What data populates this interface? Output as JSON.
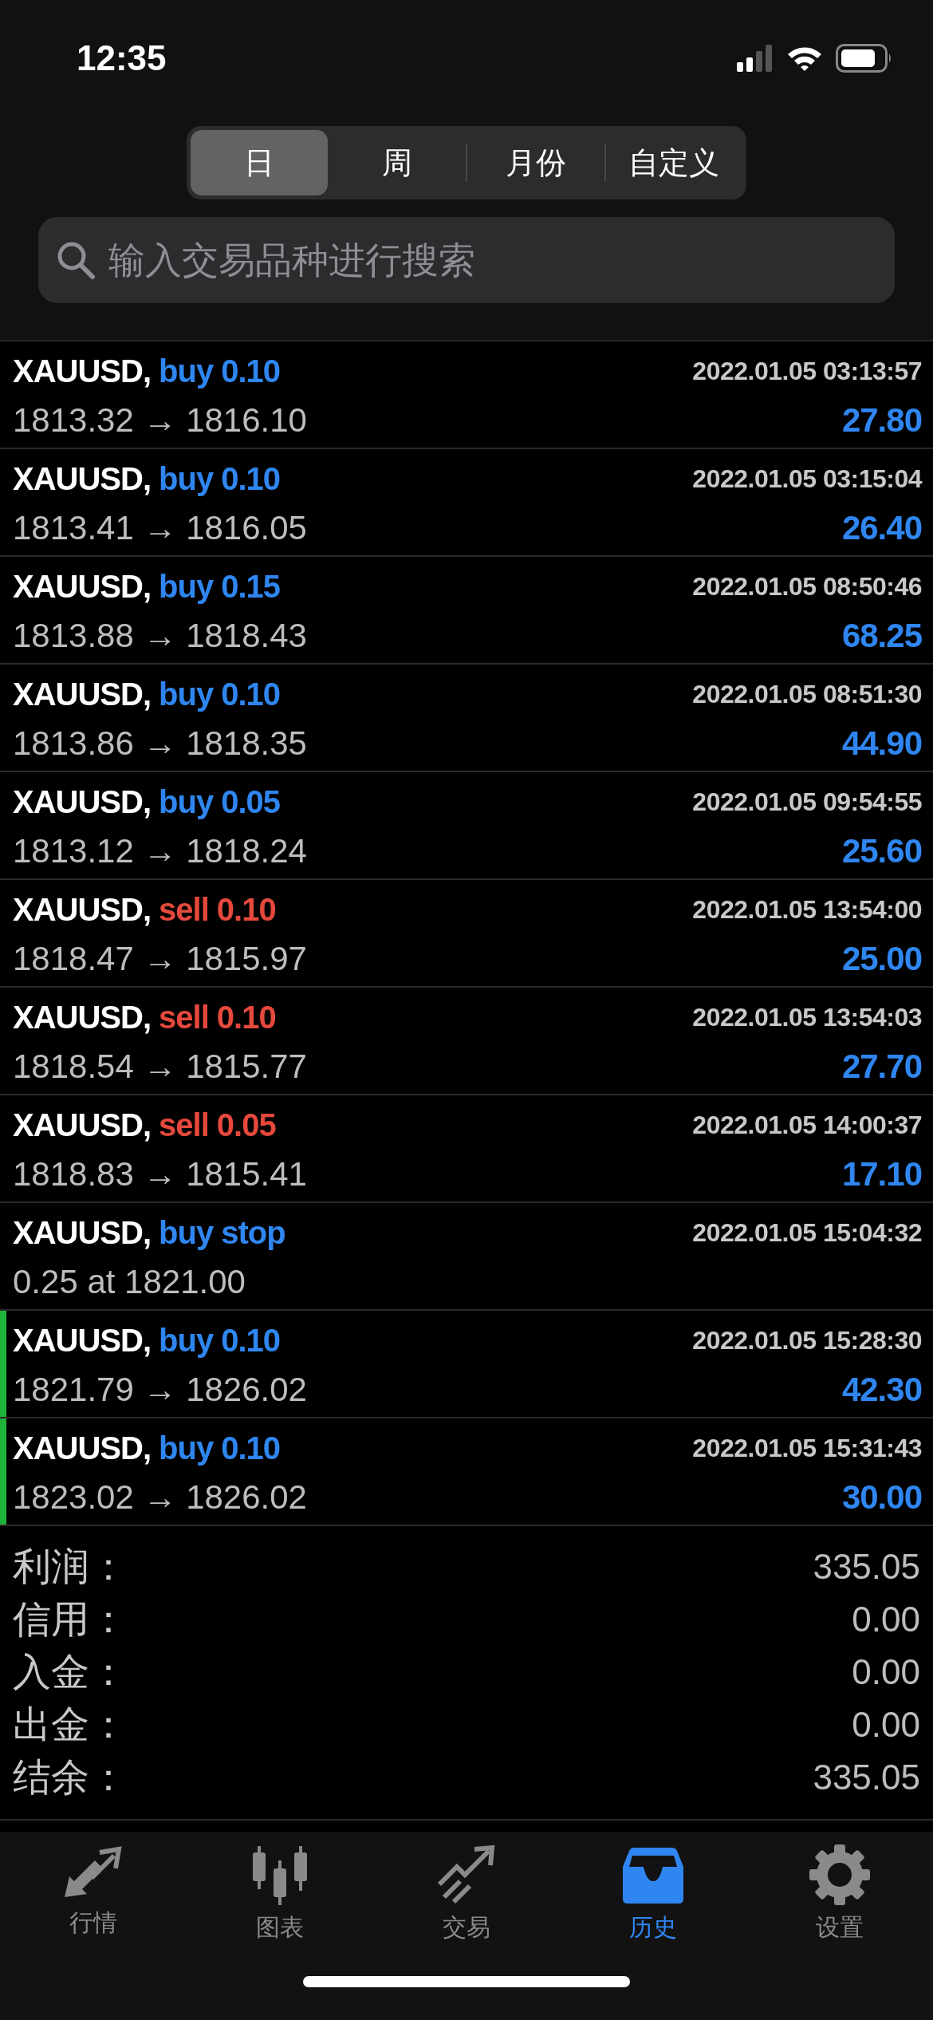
{
  "status_bar": {
    "time": "12:35"
  },
  "period_tabs": [
    {
      "label": "日",
      "selected": true
    },
    {
      "label": "周",
      "selected": false
    },
    {
      "label": "月份",
      "selected": false
    },
    {
      "label": "自定义",
      "selected": false
    }
  ],
  "search": {
    "placeholder": "输入交易品种进行搜索"
  },
  "deals": [
    {
      "kind": "deal",
      "symbol": "XAUUSD,",
      "color": "#2f86f0",
      "order": "buy 0.10",
      "time": "2022.01.05 03:13:57",
      "prices": "1813.32 → 1816.10",
      "profit": "27.80",
      "highlighted": false
    },
    {
      "kind": "deal",
      "symbol": "XAUUSD,",
      "color": "#2f86f0",
      "order": "buy 0.10",
      "time": "2022.01.05 03:15:04",
      "prices": "1813.41 → 1816.05",
      "profit": "26.40",
      "highlighted": false
    },
    {
      "kind": "deal",
      "symbol": "XAUUSD,",
      "color": "#2f86f0",
      "order": "buy 0.15",
      "time": "2022.01.05 08:50:46",
      "prices": "1813.88 → 1818.43",
      "profit": "68.25",
      "highlighted": false
    },
    {
      "kind": "deal",
      "symbol": "XAUUSD,",
      "color": "#2f86f0",
      "order": "buy 0.10",
      "time": "2022.01.05 08:51:30",
      "prices": "1813.86 → 1818.35",
      "profit": "44.90",
      "highlighted": false
    },
    {
      "kind": "deal",
      "symbol": "XAUUSD,",
      "color": "#2f86f0",
      "order": "buy 0.05",
      "time": "2022.01.05 09:54:55",
      "prices": "1813.12 → 1818.24",
      "profit": "25.60",
      "highlighted": false
    },
    {
      "kind": "deal",
      "symbol": "XAUUSD,",
      "color": "#e5483c",
      "order": "sell 0.10",
      "time": "2022.01.05 13:54:00",
      "prices": "1818.47 → 1815.97",
      "profit": "25.00",
      "highlighted": false
    },
    {
      "kind": "deal",
      "symbol": "XAUUSD,",
      "color": "#e5483c",
      "order": "sell 0.10",
      "time": "2022.01.05 13:54:03",
      "prices": "1818.54 → 1815.77",
      "profit": "27.70",
      "highlighted": false
    },
    {
      "kind": "deal",
      "symbol": "XAUUSD,",
      "color": "#e5483c",
      "order": "sell 0.05",
      "time": "2022.01.05 14:00:37",
      "prices": "1818.83 → 1815.41",
      "profit": "17.10",
      "highlighted": false
    },
    {
      "kind": "order",
      "symbol": "XAUUSD,",
      "color": "#2f86f0",
      "order": "buy stop",
      "time": "2022.01.05 15:04:32",
      "prices": "0.25 at 1821.00",
      "highlighted": false
    },
    {
      "kind": "deal",
      "symbol": "XAUUSD,",
      "color": "#2f86f0",
      "order": "buy 0.10",
      "time": "2022.01.05 15:28:30",
      "prices": "1821.79 → 1826.02",
      "profit": "42.30",
      "highlighted": true
    },
    {
      "kind": "deal",
      "symbol": "XAUUSD,",
      "color": "#2f86f0",
      "order": "buy 0.10",
      "time": "2022.01.05 15:31:43",
      "prices": "1823.02 → 1826.02",
      "profit": "30.00",
      "highlighted": true
    }
  ],
  "summary": [
    {
      "label": "利润：",
      "value": "335.05"
    },
    {
      "label": "信用：",
      "value": "0.00"
    },
    {
      "label": "入金：",
      "value": "0.00"
    },
    {
      "label": "出金：",
      "value": "0.00"
    },
    {
      "label": "结余：",
      "value": "335.05"
    }
  ],
  "tab_bar": [
    {
      "label": "行情",
      "selected": false
    },
    {
      "label": "图表",
      "selected": false
    },
    {
      "label": "交易",
      "selected": false
    },
    {
      "label": "历史",
      "selected": true
    },
    {
      "label": "设置",
      "selected": false
    }
  ]
}
